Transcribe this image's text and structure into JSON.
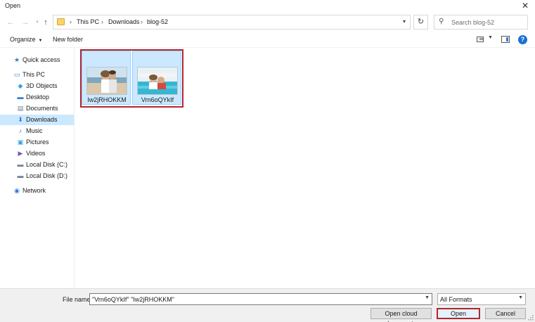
{
  "window": {
    "title": "Open",
    "close_glyph": "✕"
  },
  "navigation": {
    "breadcrumb": [
      "This PC",
      "Downloads",
      "blog-52"
    ],
    "breadcrumb_separator": "›",
    "search": {
      "placeholder": "Search blog-52",
      "value": ""
    }
  },
  "toolbar": {
    "organize_label": "Organize",
    "new_folder_label": "New folder",
    "help_glyph": "?"
  },
  "sidebar": {
    "items": [
      {
        "label": "Quick access",
        "icon": "star-icon",
        "glyph": "★",
        "color": "#2f7bd6"
      },
      {
        "label": "This PC",
        "icon": "computer-icon",
        "glyph": "▭",
        "color": "#2f7bd6"
      },
      {
        "label": "3D Objects",
        "icon": "cube-icon",
        "glyph": "◆",
        "color": "#3aa0e0"
      },
      {
        "label": "Desktop",
        "icon": "desktop-icon",
        "glyph": "▬",
        "color": "#2f7bd6"
      },
      {
        "label": "Documents",
        "icon": "document-icon",
        "glyph": "▤",
        "color": "#6f7f8f"
      },
      {
        "label": "Downloads",
        "icon": "download-icon",
        "glyph": "⬇",
        "color": "#2f7bd6",
        "selected": true
      },
      {
        "label": "Music",
        "icon": "music-icon",
        "glyph": "♪",
        "color": "#2f7bd6"
      },
      {
        "label": "Pictures",
        "icon": "pictures-icon",
        "glyph": "▣",
        "color": "#3aa0e0"
      },
      {
        "label": "Videos",
        "icon": "video-icon",
        "glyph": "▶",
        "color": "#6f5fb0"
      },
      {
        "label": "Local Disk (C:)",
        "icon": "disk-icon",
        "glyph": "▬",
        "color": "#6f7f8f"
      },
      {
        "label": "Local Disk (D:)",
        "icon": "disk-icon",
        "glyph": "▬",
        "color": "#6f7f8f"
      },
      {
        "label": "Network",
        "icon": "network-icon",
        "glyph": "◉",
        "color": "#2f7bd6"
      }
    ]
  },
  "files": [
    {
      "name": "Iw2jRHOKKM",
      "thumbnail": "couple-beach-photo",
      "selected": true
    },
    {
      "name": "Vrn6oQYkIf",
      "thumbnail": "couple-pool-photo",
      "selected": true
    }
  ],
  "footer": {
    "file_name_label": "File name:",
    "file_name_value": "\"Vrn6oQYkIf\" \"Iw2jRHOKKM\"",
    "format_value": "All Formats",
    "cloud_button": "Open cloud documents",
    "open_button": "Open",
    "cancel_button": "Cancel"
  },
  "colors": {
    "selection": "#cce8ff",
    "highlight": "#b3262d",
    "accent": "#1b6fd1"
  }
}
